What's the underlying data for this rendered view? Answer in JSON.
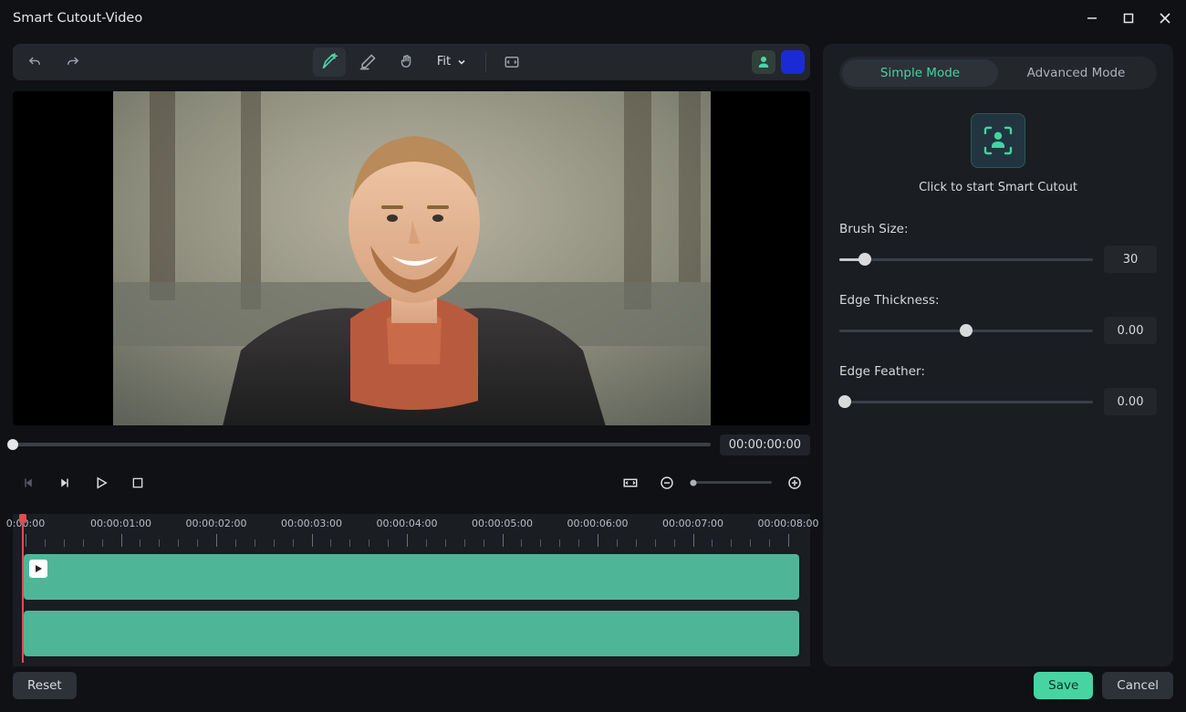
{
  "window": {
    "title": "Smart Cutout-Video"
  },
  "toolbar": {
    "icons": {
      "undo": "undo-icon",
      "redo": "redo-icon",
      "add_brush": "add-brush-icon",
      "erase_brush": "erase-brush-icon",
      "hand": "hand-icon",
      "compare": "compare-icon",
      "person_swatch": "person-swatch-icon"
    },
    "zoom_label": "Fit",
    "swatch_color": "#1a2bd6"
  },
  "transport": {
    "timecode": "00:00:00:00"
  },
  "timeline": {
    "labels": [
      "0:00:00",
      "00:00:01:00",
      "00:00:02:00",
      "00:00:03:00",
      "00:00:04:00",
      "00:00:05:00",
      "00:00:06:00",
      "00:00:07:00",
      "00:00:08:00"
    ]
  },
  "panel": {
    "tabs": {
      "simple": "Simple Mode",
      "advanced": "Advanced Mode"
    },
    "start_label": "Click to start Smart Cutout",
    "brush_size": {
      "label": "Brush Size:",
      "value": "30",
      "percent": 10
    },
    "edge_thickness": {
      "label": "Edge Thickness:",
      "value": "0.00",
      "percent": 50
    },
    "edge_feather": {
      "label": "Edge Feather:",
      "value": "0.00",
      "percent": 2
    }
  },
  "footer": {
    "reset": "Reset",
    "save": "Save",
    "cancel": "Cancel"
  }
}
